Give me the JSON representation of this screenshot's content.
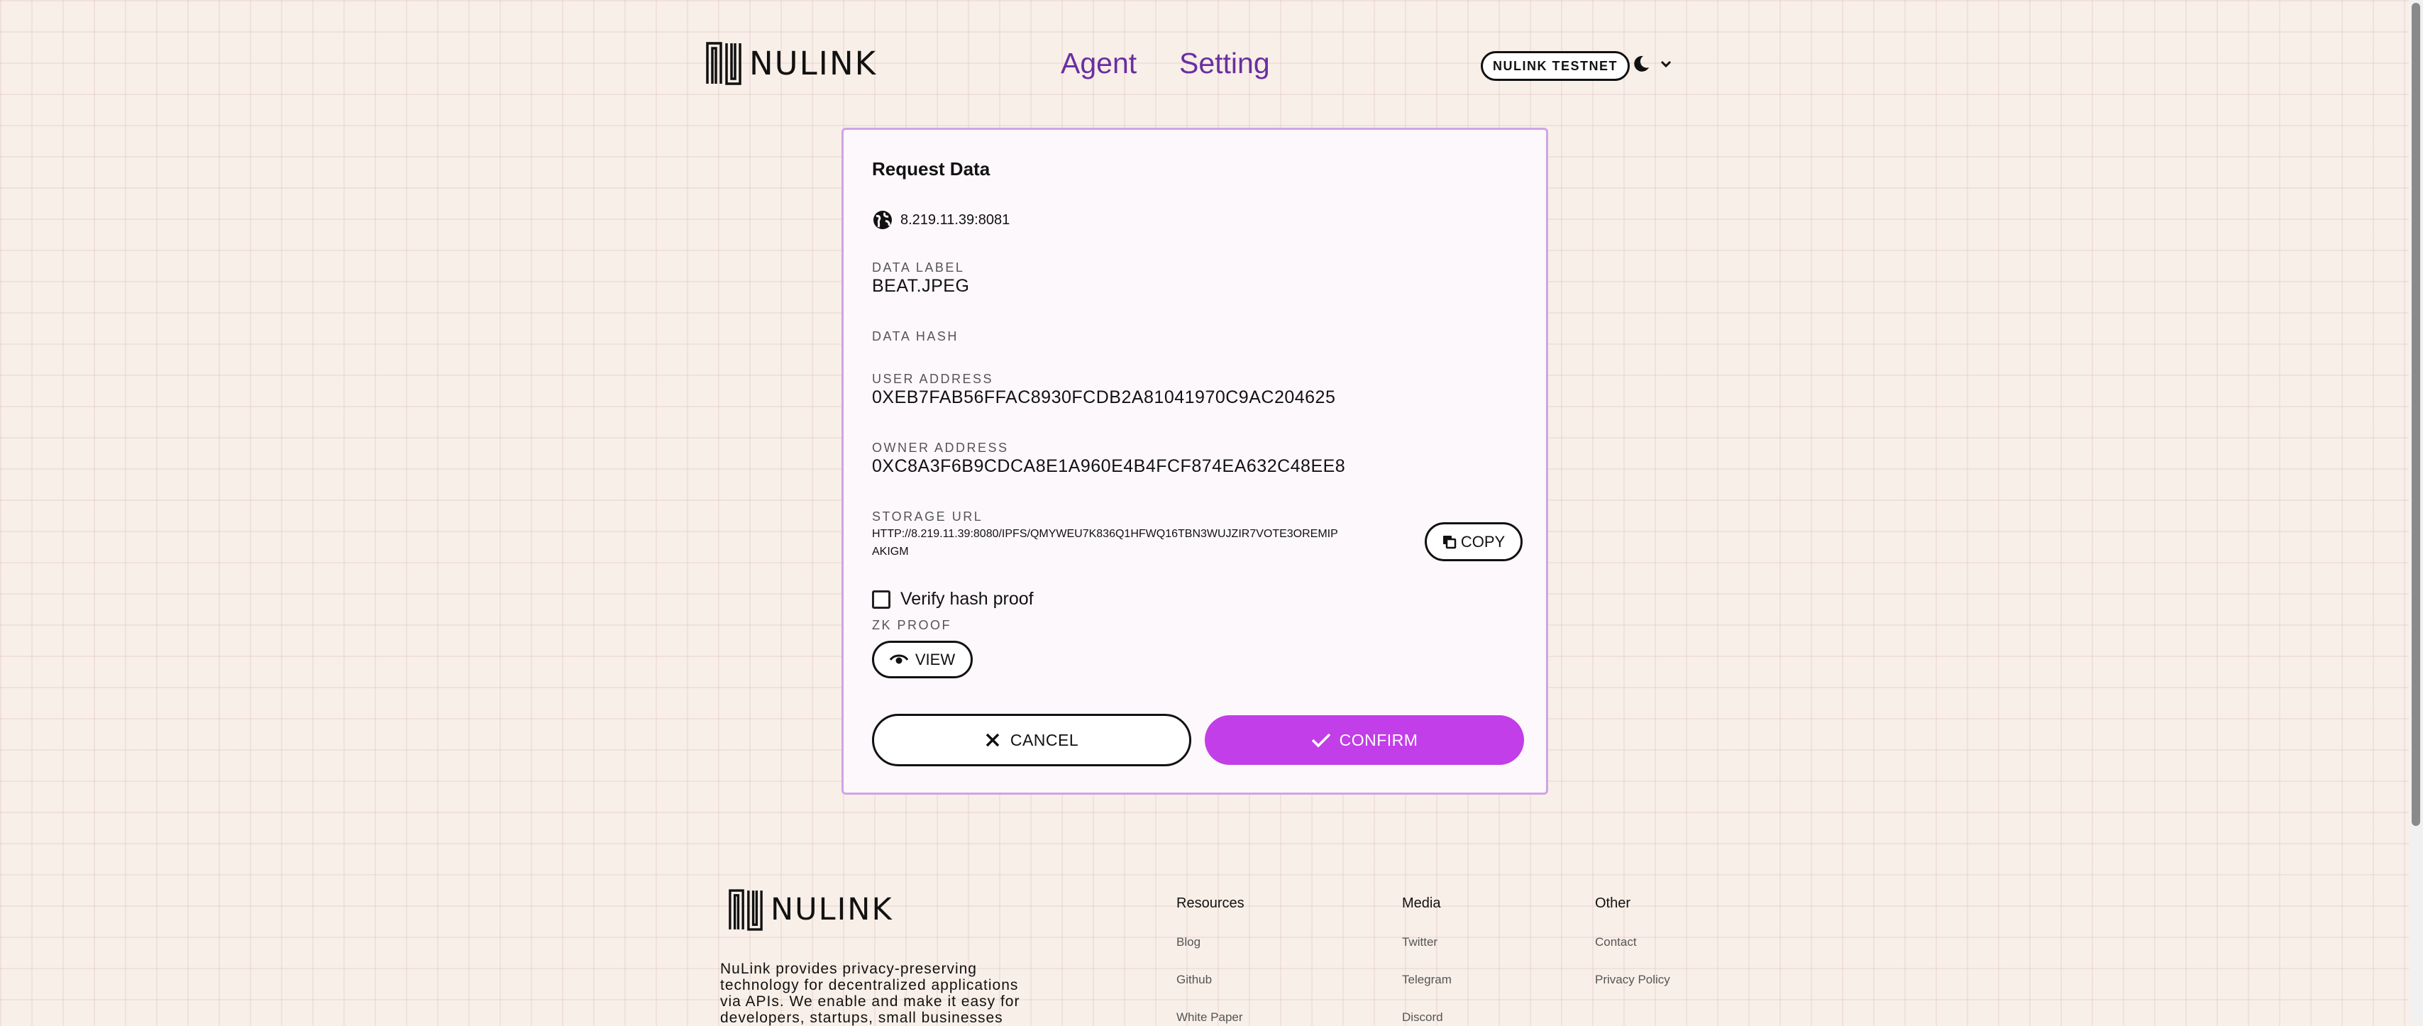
{
  "header": {
    "logo_text": "NULINK",
    "nav": [
      {
        "label": "Agent"
      },
      {
        "label": "Setting"
      }
    ],
    "network_label": "NULINK TESTNET"
  },
  "modal": {
    "title": "Request Data",
    "host": "8.219.11.39:8081",
    "data_label": {
      "label": "DATA LABEL",
      "value": "BEAT.JPEG"
    },
    "data_hash": {
      "label": "DATA HASH",
      "value": ""
    },
    "user_address": {
      "label": "USER ADDRESS",
      "value": "0XEB7FAB56FFAC8930FCDB2A81041970C9AC204625"
    },
    "owner_address": {
      "label": "OWNER ADDRESS",
      "value": "0XC8A3F6B9CDCA8E1A960E4B4FCF874EA632C48EE8"
    },
    "storage_url": {
      "label": "STORAGE URL",
      "line1": "HTTP://8.219.11.39:8080/IPFS/QMYWEU7K836Q1HFWQ16TBN3WUJZIR7VOTE3OREMIP",
      "line2": "AKIGM"
    },
    "copy_label": "COPY",
    "verify_label": "Verify hash proof",
    "verify_checked": false,
    "zk_label": "ZK PROOF",
    "view_label": "VIEW",
    "cancel_label": "CANCEL",
    "confirm_label": "CONFIRM"
  },
  "footer": {
    "logo_text": "NULINK",
    "about_lines": [
      "NuLink provides privacy-preserving",
      "technology for decentralized applications",
      "via APIs. We enable and make it easy for",
      "developers, startups, small businesses"
    ],
    "columns": [
      {
        "heading": "Resources",
        "links": [
          "Blog",
          "Github",
          "White Paper"
        ]
      },
      {
        "heading": "Media",
        "links": [
          "Twitter",
          "Telegram",
          "Discord"
        ]
      },
      {
        "heading": "Other",
        "links": [
          "Contact",
          "Privacy Policy"
        ]
      }
    ]
  },
  "colors": {
    "background": "#f8efe8",
    "accent": "#c23ee8",
    "nav_text": "#6a2fa0",
    "modal_border": "#cfa4e6"
  }
}
